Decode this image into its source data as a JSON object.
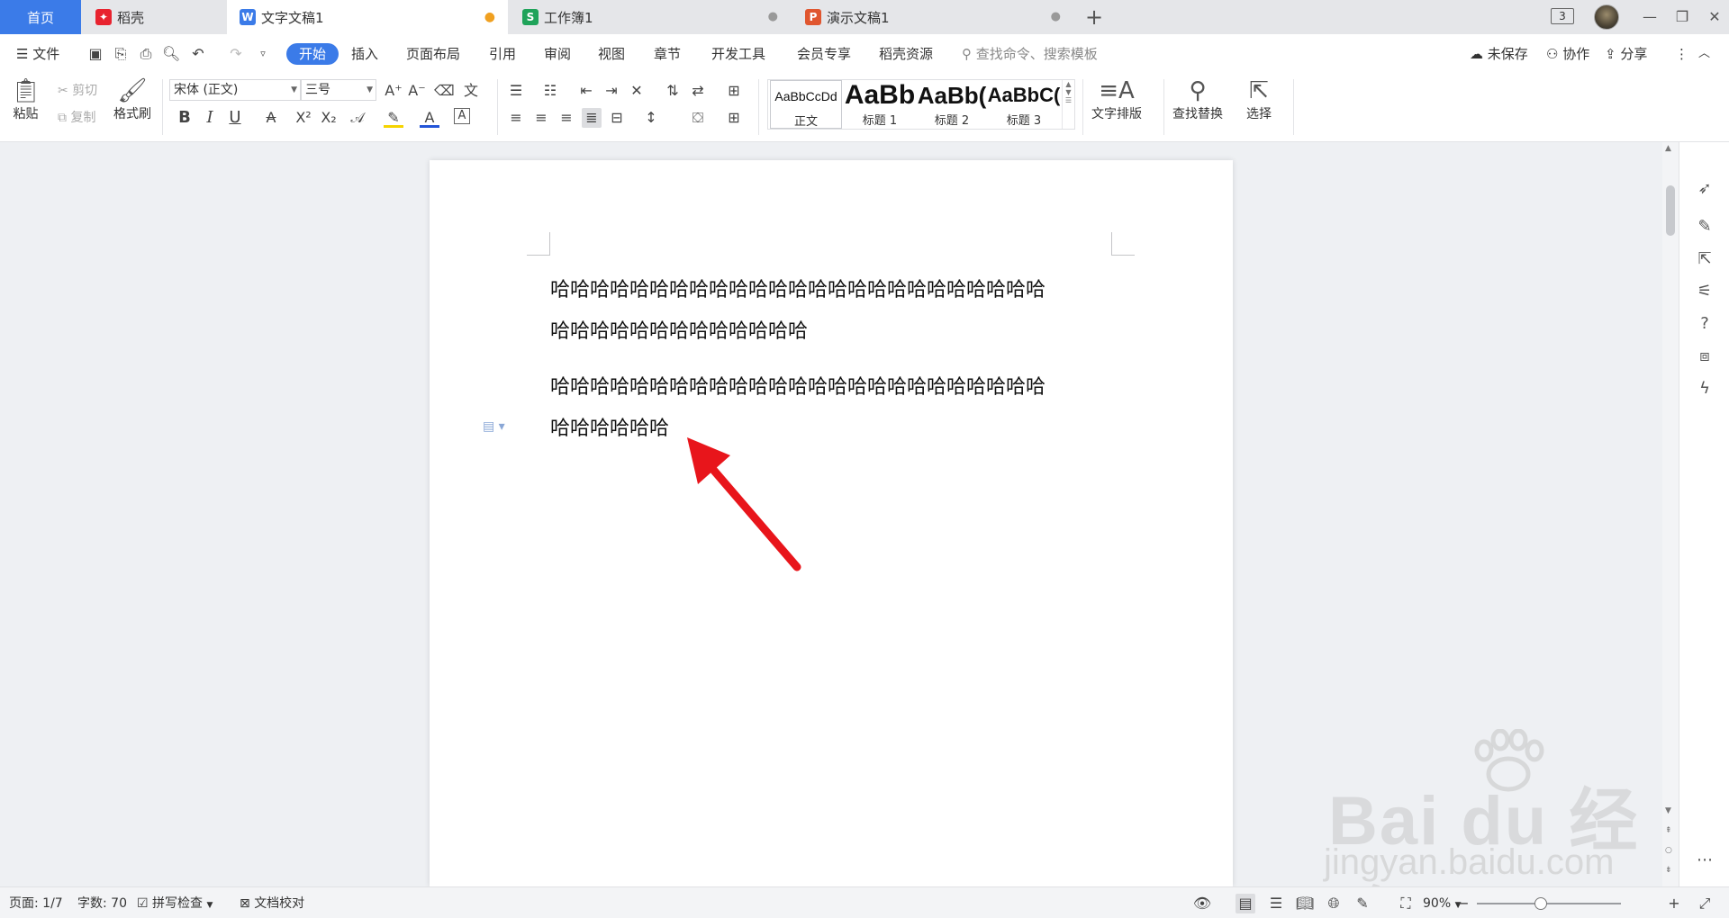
{
  "tabs": {
    "home": "首页",
    "daoke": "稻壳",
    "doc": "文字文稿1",
    "sheet": "工作簿1",
    "ppt": "演示文稿1",
    "window_count": "3"
  },
  "menu": {
    "file": "文件",
    "items": [
      "开始",
      "插入",
      "页面布局",
      "引用",
      "审阅",
      "视图",
      "章节",
      "开发工具",
      "会员专享",
      "稻壳资源"
    ],
    "search_placeholder": "查找命令、搜索模板",
    "unsaved": "未保存",
    "collab": "协作",
    "share": "分享"
  },
  "ribbon": {
    "paste": "粘贴",
    "cut": "剪切",
    "copy": "复制",
    "format_painter": "格式刷",
    "font_name": "宋体 (正文)",
    "font_size": "三号",
    "styles": [
      {
        "sample": "AaBbCcDd",
        "name": "正文"
      },
      {
        "sample": "AaBb",
        "name": "标题 1"
      },
      {
        "sample": "AaBb(",
        "name": "标题 2"
      },
      {
        "sample": "AaBbC(",
        "name": "标题 3"
      }
    ],
    "text_layout": "文字排版",
    "find_replace": "查找替换",
    "select": "选择"
  },
  "document": {
    "paragraphs": [
      {
        "line1": "哈哈哈哈哈哈哈哈哈哈哈哈哈哈哈哈哈哈哈哈哈哈哈哈哈",
        "line2": "哈哈哈哈哈哈哈哈哈哈哈哈哈"
      },
      {
        "line1": "哈哈哈哈哈哈哈哈哈哈哈哈哈哈哈哈哈哈哈哈哈哈哈哈哈",
        "line2": "哈哈哈哈哈哈"
      }
    ]
  },
  "status": {
    "page": "页面: 1/7",
    "word_count": "字数: 70",
    "spell_check": "拼写检查",
    "doc_proof": "文档校对",
    "zoom": "90%",
    "zoom_level_percent": 90
  },
  "watermark": {
    "logo": "Bai du 经验",
    "url": "jingyan.baidu.com"
  },
  "colors": {
    "accent": "#3b7be8",
    "arrow": "#e8151b",
    "writer": "#3b7be8",
    "spreadsheet": "#1fa35a",
    "presentation": "#e0562f",
    "daoke": "#e8232f"
  }
}
